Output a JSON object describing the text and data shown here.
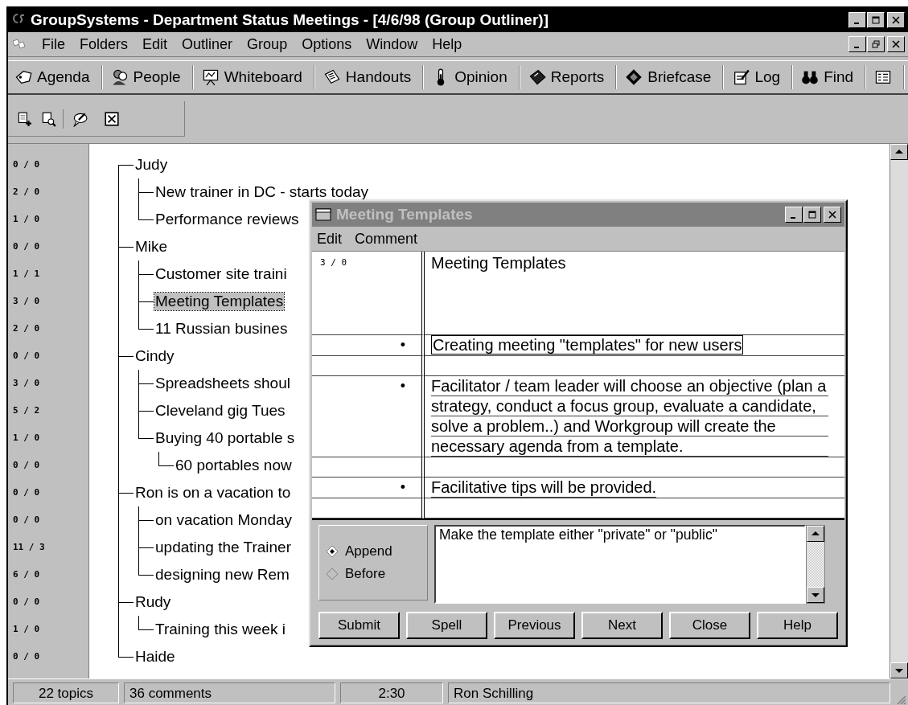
{
  "window": {
    "title": "GroupSystems - Department Status Meetings - [4/6/98 (Group Outliner)]"
  },
  "menu": [
    "File",
    "Folders",
    "Edit",
    "Outliner",
    "Group",
    "Options",
    "Window",
    "Help"
  ],
  "toolbar": [
    {
      "label": "Agenda",
      "kind": "agenda"
    },
    {
      "label": "People",
      "kind": "people"
    },
    {
      "label": "Whiteboard",
      "kind": "whiteboard"
    },
    {
      "label": "Handouts",
      "kind": "handouts"
    },
    {
      "label": "Opinion",
      "kind": "opinion"
    },
    {
      "label": "Reports",
      "kind": "reports"
    },
    {
      "label": "Briefcase",
      "kind": "briefcase"
    },
    {
      "label": "Log",
      "kind": "log"
    },
    {
      "label": "Find",
      "kind": "find"
    },
    {
      "kind": "list"
    }
  ],
  "tool_icons": [
    {
      "kind": "add"
    },
    {
      "kind": "preview"
    },
    {
      "kind": "comment"
    },
    {
      "kind": "delete"
    }
  ],
  "outline": [
    {
      "count": "0 / 0",
      "label": "Judy",
      "selected": false,
      "children": [
        {
          "count": "2 / 0",
          "label": "New trainer in DC - starts today",
          "selected": false
        },
        {
          "count": "1 / 0",
          "label": "Performance reviews",
          "selected": false
        }
      ]
    },
    {
      "count": "0 / 0",
      "label": "Mike",
      "selected": false,
      "children": [
        {
          "count": "1 / 1",
          "label": "Customer site traini",
          "selected": false
        },
        {
          "count": "3 / 0",
          "label": "Meeting Templates",
          "selected": true
        },
        {
          "count": "2 / 0",
          "label": "11 Russian busines",
          "selected": false
        }
      ]
    },
    {
      "count": "0 / 0",
      "label": "Cindy",
      "selected": false,
      "children": [
        {
          "count": "3 / 0",
          "label": "Spreadsheets shoul",
          "selected": false
        },
        {
          "count": "5 / 2",
          "label": "Cleveland gig Tues",
          "selected": false
        },
        {
          "count": "1 / 0",
          "label": "Buying 40 portable s",
          "selected": false,
          "children": [
            {
              "count": "0 / 0",
              "label": "60 portables now",
              "selected": false
            }
          ]
        }
      ]
    },
    {
      "count": "0 / 0",
      "label": "Ron is on a vacation to",
      "selected": false,
      "children": [
        {
          "count": "0 / 0",
          "label": "on vacation Monday",
          "selected": false
        },
        {
          "count": "11 / 3",
          "label": "updating the Trainer",
          "selected": false
        },
        {
          "count": "6 / 0",
          "label": "designing new Rem",
          "selected": false
        }
      ]
    },
    {
      "count": "0 / 0",
      "label": "Rudy",
      "selected": false,
      "children": [
        {
          "count": "1 / 0",
          "label": "Training this week i",
          "selected": false
        }
      ]
    },
    {
      "count": "0 / 0",
      "label": "Haide",
      "selected": false
    }
  ],
  "dialog": {
    "title": "Meeting Templates",
    "menu": [
      "Edit",
      "Comment"
    ],
    "header": {
      "count": "3 / 0",
      "title": "Meeting Templates"
    },
    "entries": [
      {
        "marker": "•",
        "text": "Creating meeting \"templates\" for new users",
        "selected": true
      },
      {
        "marker": "•",
        "text": "Facilitator / team leader will choose an objective (plan a strategy, conduct a focus group, evaluate a candidate, solve a problem..) and Workgroup will create the necessary agenda from a template.",
        "selected": false
      },
      {
        "marker": "•",
        "text": "Facilitative tips will be provided.",
        "selected": false
      }
    ],
    "options": [
      {
        "label": "Append",
        "selected": true
      },
      {
        "label": "Before",
        "selected": false
      }
    ],
    "comment_field": {
      "value": "Make the template either \"private\" or \"public\""
    },
    "buttons": [
      "Submit",
      "Spell",
      "Previous",
      "Next",
      "Close",
      "Help"
    ]
  },
  "status_bar": [
    "22 topics",
    "36 comments",
    "2:30",
    "Ron Schilling"
  ]
}
